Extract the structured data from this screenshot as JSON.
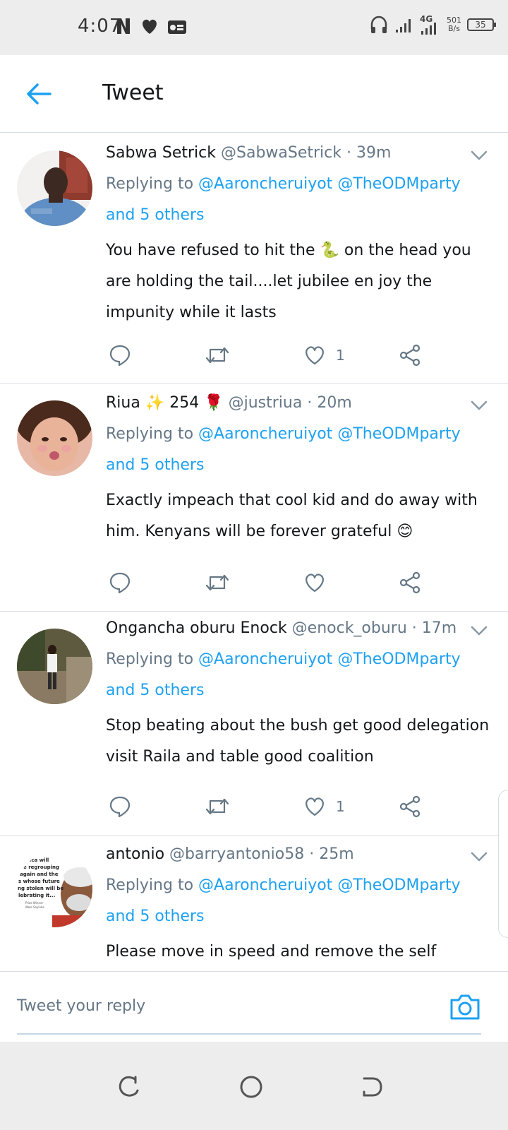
{
  "status_bar": {
    "time": "4:07",
    "network_type": "4G",
    "net_speed_value": "501",
    "net_speed_unit": "B/s",
    "battery_level": "35"
  },
  "header": {
    "title": "Tweet"
  },
  "colors": {
    "accent": "#1da1f2",
    "text_primary": "#14171a",
    "text_secondary": "#657786",
    "divider": "#d8dde2",
    "system_bar": "#ededed"
  },
  "tweets": [
    {
      "display_name": "Sabwa Setrick",
      "handle": "@SabwaSetrick",
      "time": "39m",
      "replying_prefix": "Replying to",
      "mention_1": "@Aaroncheruiyot",
      "mention_2": "@TheODMparty",
      "others": "and 5 others",
      "text_before_emoji": "You have refused to hit the",
      "emoji": "🐍",
      "text_after_emoji": "on the head you are holding the tail....let  jubilee en joy the impunity while it lasts",
      "like_count": "1"
    },
    {
      "display_name": "Riua",
      "name_emojis": "✨ 254 🌹",
      "handle": "@justriua",
      "time": "20m",
      "replying_prefix": "Replying to",
      "mention_1": "@Aaroncheruiyot",
      "mention_2": "@TheODMparty",
      "others": "and 5 others",
      "text": "Exactly impeach that cool kid and do away with him. Kenyans will be forever grateful",
      "emoji": "😊",
      "like_count": ""
    },
    {
      "display_name": "Ongancha oburu Enock",
      "handle": "@enock_oburu",
      "time": "17m",
      "replying_prefix": "Replying to",
      "mention_1": "@Aaroncheruiyot",
      "mention_2": "@TheODMparty",
      "others": "and 5 others",
      "text": "Stop beating about the bush get good delegation visit Raila and table good coalition",
      "like_count": "1"
    },
    {
      "display_name": "antonio",
      "handle": "@barryantonio58",
      "time": "25m",
      "replying_prefix": "Replying to",
      "mention_1": "@Aaroncheruiyot",
      "mention_2": "@TheODMparty",
      "others": "and 5 others",
      "text": "Please move in speed and remove the self",
      "avatar_lines": [
        "Africa will",
        "be regrouping",
        "again and the",
        "s whose future",
        "ng stolen will be",
        "lebrating it...",
        "Prize Winner",
        "Wole Soyinka"
      ]
    }
  ],
  "reply_bar": {
    "placeholder": "Tweet your reply"
  },
  "icons": {
    "back": "arrow-left-icon",
    "caret": "chevron-down-icon",
    "reply": "comment-icon",
    "retweet": "retweet-icon",
    "like": "heart-icon",
    "share": "share-icon",
    "camera": "camera-icon"
  }
}
